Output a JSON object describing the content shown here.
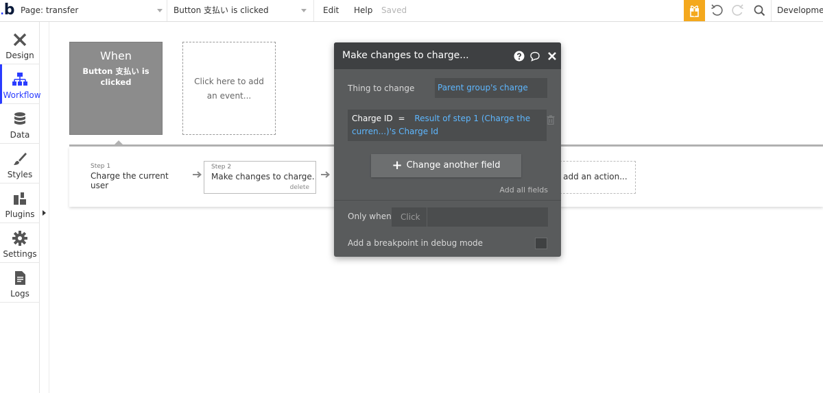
{
  "topbar": {
    "logo": "b",
    "page_select": "Page: transfer",
    "event_select": "Button 支払い is clicked",
    "menu_edit": "Edit",
    "menu_help": "Help",
    "status": "Saved",
    "environment": "Development"
  },
  "sidebar": {
    "items": [
      {
        "label": "Design",
        "icon": "design-icon"
      },
      {
        "label": "Workflow",
        "icon": "workflow-icon"
      },
      {
        "label": "Data",
        "icon": "database-icon"
      },
      {
        "label": "Styles",
        "icon": "brush-icon"
      },
      {
        "label": "Plugins",
        "icon": "plug-icon"
      },
      {
        "label": "Settings",
        "icon": "gear-icon"
      },
      {
        "label": "Logs",
        "icon": "document-icon"
      }
    ],
    "active": "Workflow"
  },
  "canvas": {
    "when_title": "When",
    "when_event": "Button 支払い is clicked",
    "add_event": "Click here to add an event...",
    "steps": [
      {
        "number": "Step 1",
        "label": "Charge the current user"
      },
      {
        "number": "Step 2",
        "label": "Make changes to charge...",
        "delete": "delete"
      }
    ],
    "add_action": "Click here to add an action..."
  },
  "panel": {
    "title": "Make changes to charge...",
    "thing_label": "Thing to change",
    "thing_value": "Parent group's charge",
    "field_name": "Charge ID",
    "field_eq": "=",
    "field_value": "Result of step 1 (Charge the curren...)'s Charge Id",
    "change_button": "Change another field",
    "add_all": "Add all fields",
    "only_when_label": "Only when",
    "only_when_value": "Click",
    "debug_label": "Add a breakpoint in debug mode"
  },
  "colors": {
    "accent": "#2a3cff",
    "gift": "#f4a81d",
    "panel_bg": "#595b5c",
    "panel_head": "#3e4042",
    "link_blue": "#5eb7ff"
  }
}
